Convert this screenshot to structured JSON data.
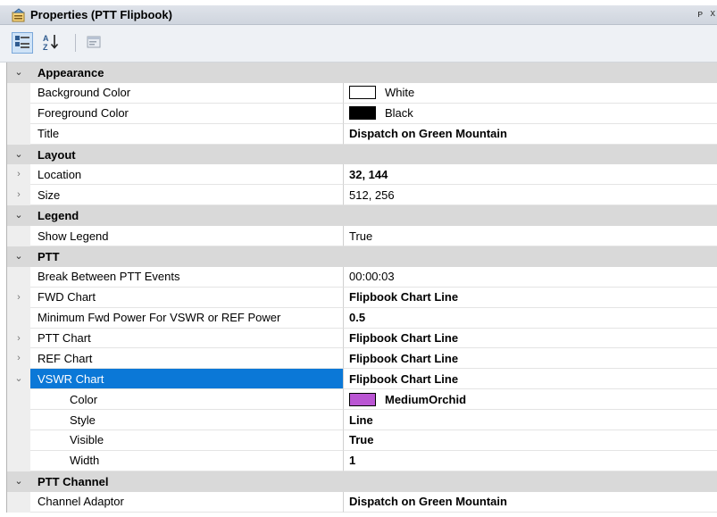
{
  "window": {
    "title": "Properties (PTT Flipbook)",
    "pin_glyph": "ᴘ",
    "close_glyph": "x"
  },
  "toolbar": {
    "categorized_tooltip": "Categorized",
    "alphabetical_tooltip": "Alphabetical",
    "pages_tooltip": "Property Pages"
  },
  "categories": [
    {
      "name": "Appearance"
    },
    {
      "name": "Layout"
    },
    {
      "name": "Legend"
    },
    {
      "name": "PTT"
    },
    {
      "name": "PTT Channel"
    }
  ],
  "properties": {
    "background_color": {
      "name": "Background Color",
      "value": "White",
      "swatch": "#ffffff"
    },
    "foreground_color": {
      "name": "Foreground Color",
      "value": "Black",
      "swatch": "#000000"
    },
    "title": {
      "name": "Title",
      "value": "Dispatch on Green Mountain"
    },
    "location": {
      "name": "Location",
      "value": "32, 144"
    },
    "size": {
      "name": "Size",
      "value": "512, 256"
    },
    "show_legend": {
      "name": "Show Legend",
      "value": "True"
    },
    "break_between": {
      "name": "Break Between PTT Events",
      "value": "00:00:03"
    },
    "fwd_chart": {
      "name": "FWD Chart",
      "value": "Flipbook Chart Line"
    },
    "min_fwd_power": {
      "name": "Minimum Fwd Power For VSWR or REF Power",
      "value": "0.5"
    },
    "ptt_chart": {
      "name": "PTT Chart",
      "value": "Flipbook Chart Line"
    },
    "ref_chart": {
      "name": "REF Chart",
      "value": "Flipbook Chart Line"
    },
    "vswr_chart": {
      "name": "VSWR Chart",
      "value": "Flipbook Chart Line"
    },
    "vswr_color": {
      "name": "Color",
      "value": "MediumOrchid",
      "swatch": "#ba55d3"
    },
    "vswr_style": {
      "name": "Style",
      "value": "Line"
    },
    "vswr_visible": {
      "name": "Visible",
      "value": "True"
    },
    "vswr_width": {
      "name": "Width",
      "value": "1"
    },
    "channel_adaptor": {
      "name": "Channel Adaptor",
      "value": "Dispatch on Green Mountain"
    }
  },
  "colors": {
    "selection": "#0b78d7",
    "category_bg": "#d9d9d9",
    "gutter_bg": "#eeeeee"
  }
}
